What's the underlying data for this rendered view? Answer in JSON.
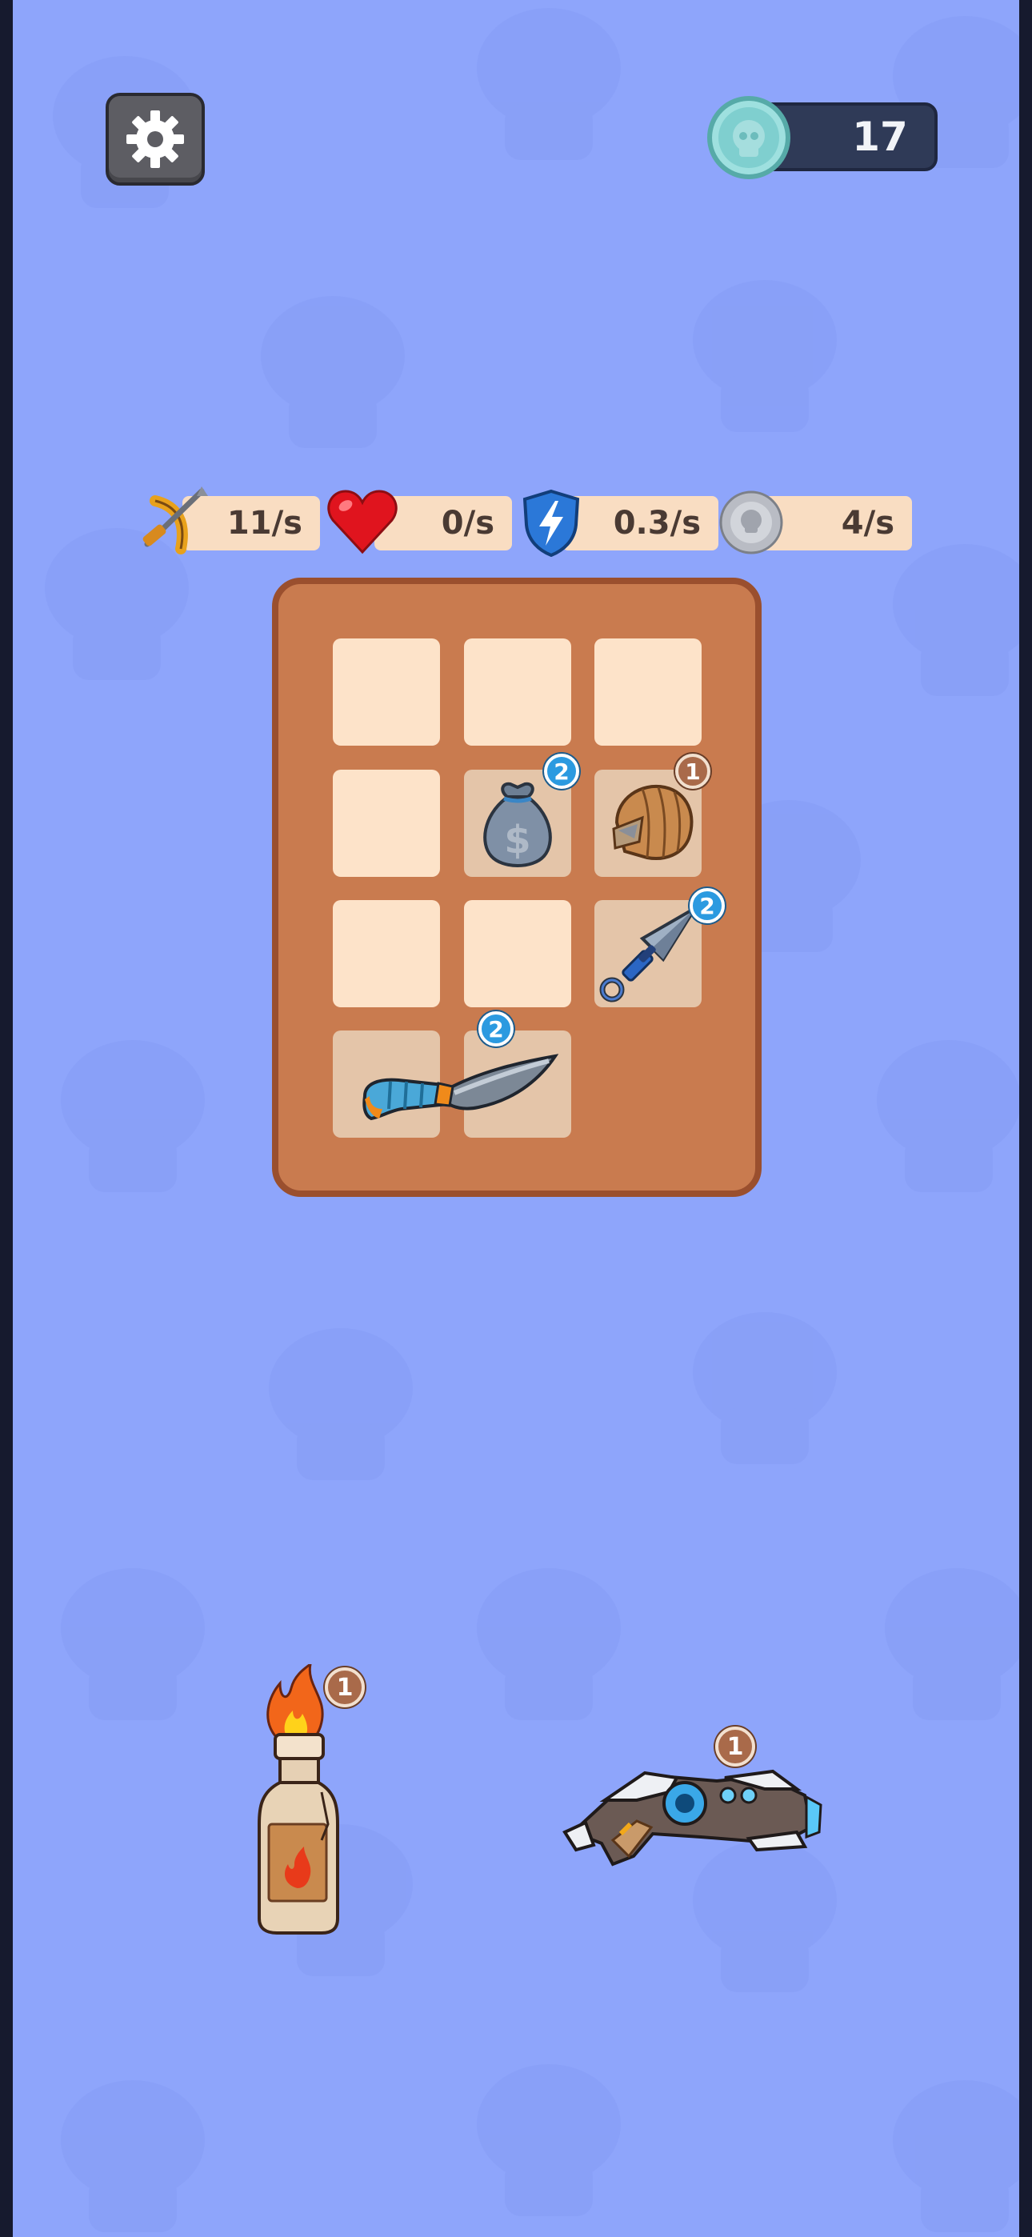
{
  "hud": {
    "coins": "17",
    "settings_icon": "gear-icon",
    "coin_icon": "skull-coin-icon"
  },
  "stats": [
    {
      "icon": "crossbow-icon",
      "value": "11/s"
    },
    {
      "icon": "heart-icon",
      "value": "0/s"
    },
    {
      "icon": "lightning-shield-icon",
      "value": "0.3/s"
    },
    {
      "icon": "silver-coin-icon",
      "value": "4/s"
    }
  ],
  "board": {
    "items": [
      {
        "name": "money-bag",
        "icon": "money-bag-icon",
        "level": "2"
      },
      {
        "name": "leather-glove",
        "icon": "glove-icon",
        "level": "1"
      },
      {
        "name": "kunai",
        "icon": "kunai-icon",
        "level": "2"
      },
      {
        "name": "curved-knife",
        "icon": "knife-icon",
        "level": "2"
      }
    ]
  },
  "spawn": {
    "items": [
      {
        "name": "molotov",
        "icon": "molotov-icon",
        "level": "1"
      },
      {
        "name": "blaster",
        "icon": "blaster-gun-icon",
        "level": "1"
      }
    ]
  },
  "colors": {
    "background": "#8ea5fb",
    "board": "#c97b4f",
    "cell": "#fde3c9",
    "badge_blue": "#2b9ae0",
    "badge_brown": "#a96a4a"
  }
}
